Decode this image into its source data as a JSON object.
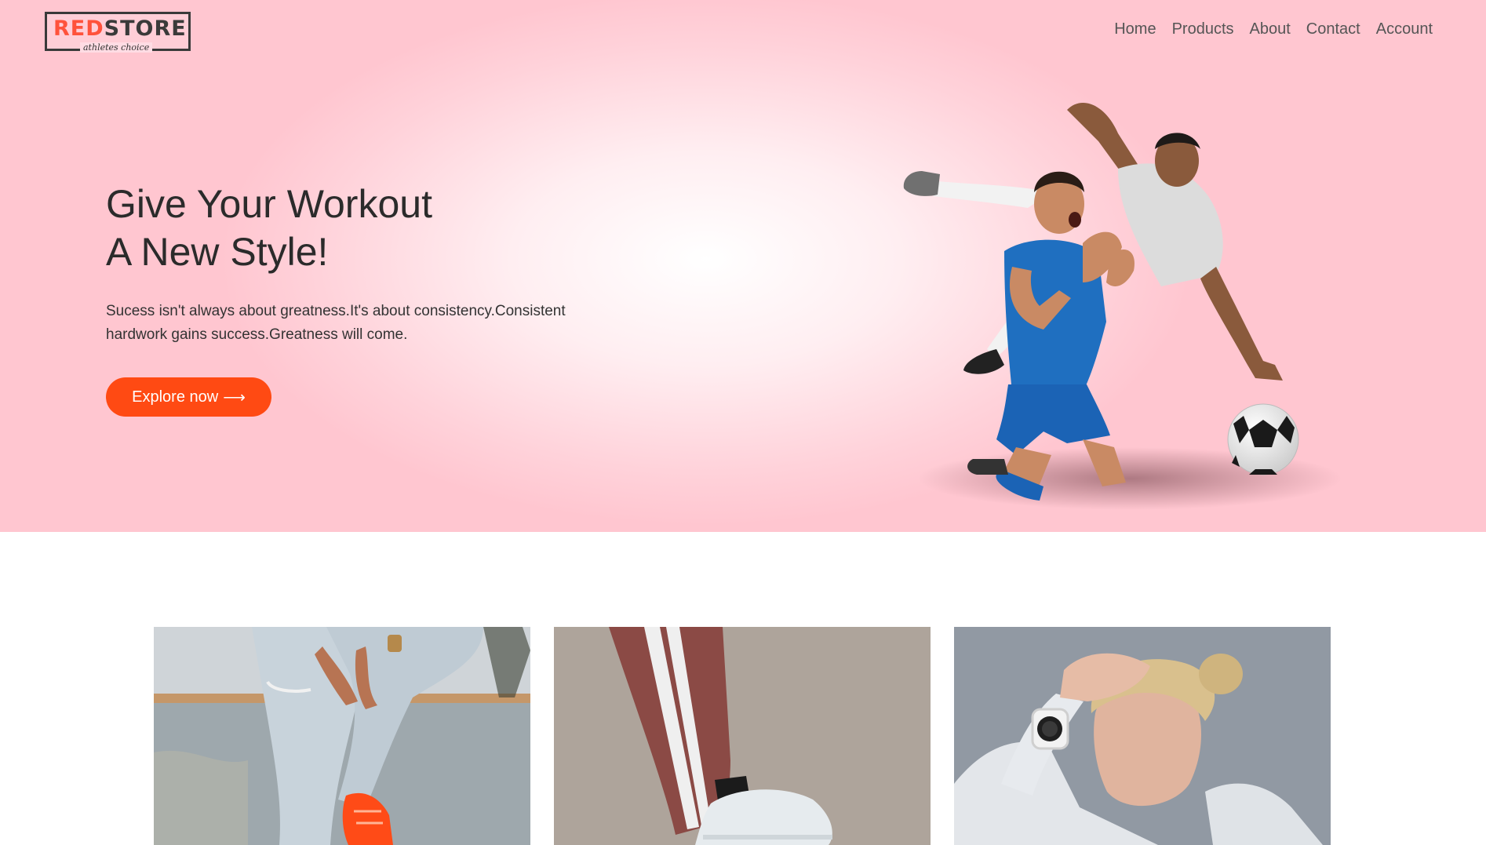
{
  "brand": {
    "name_part1": "RED",
    "name_part2": "STORE",
    "tagline": "athletes choice",
    "accent_color": "#ff523b"
  },
  "nav": {
    "items": [
      {
        "label": "Home"
      },
      {
        "label": "Products"
      },
      {
        "label": "About"
      },
      {
        "label": "Contact"
      },
      {
        "label": "Account"
      }
    ]
  },
  "hero": {
    "title_line1": "Give Your Workout",
    "title_line2": "A New Style!",
    "description": "Sucess isn't always about greatness.It's about consistency.Consistent hardwork gains success.Greatness will come.",
    "cta_label": "Explore now",
    "cta_icon": "arrow-right-icon",
    "cta_color": "#ff4a13",
    "image": "soccer-players-celebrating"
  },
  "categories": [
    {
      "image": "jeans-orange-sneakers"
    },
    {
      "image": "track-pants-white-sneaker"
    },
    {
      "image": "woman-smartwatch-hoodie"
    }
  ]
}
